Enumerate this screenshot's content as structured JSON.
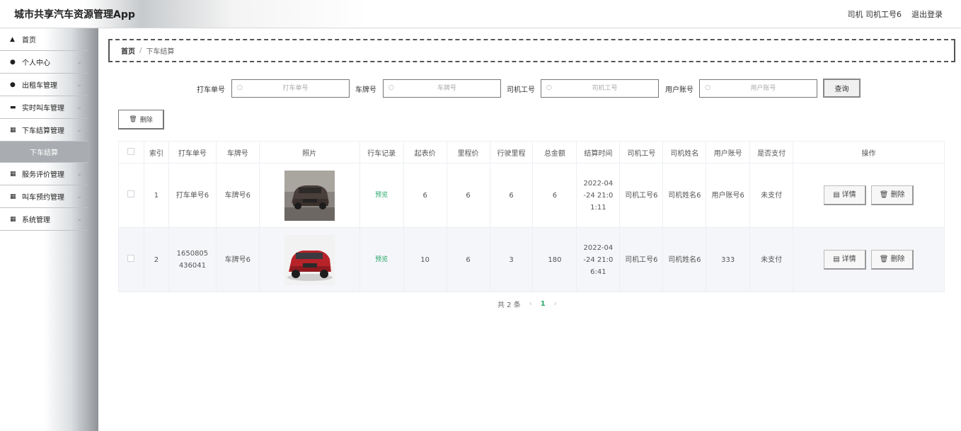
{
  "app": {
    "title": "城市共享汽车资源管理App"
  },
  "header": {
    "role_text": "司机 司机工号6",
    "logout_label": "退出登录"
  },
  "sidebar": {
    "items": [
      {
        "label": "首页",
        "icon": "home-icon",
        "has_chevron": false
      },
      {
        "label": "个人中心",
        "icon": "user-icon",
        "has_chevron": true
      },
      {
        "label": "出租车管理",
        "icon": "user-icon",
        "has_chevron": true
      },
      {
        "label": "实时叫车管理",
        "icon": "monitor-icon",
        "has_chevron": true
      },
      {
        "label": "下车结算管理",
        "icon": "grid-icon",
        "has_chevron": true
      },
      {
        "label": "下车结算",
        "icon": "",
        "has_chevron": false,
        "sub": true
      },
      {
        "label": "服务评价管理",
        "icon": "grid-icon",
        "has_chevron": true
      },
      {
        "label": "叫车预约管理",
        "icon": "grid-icon",
        "has_chevron": true
      },
      {
        "label": "系统管理",
        "icon": "grid-icon",
        "has_chevron": true
      }
    ]
  },
  "breadcrumb": {
    "home": "首页",
    "separator": "/",
    "current": "下车结算"
  },
  "search": {
    "fields": [
      {
        "label": "打车单号",
        "placeholder": "打车单号"
      },
      {
        "label": "车牌号",
        "placeholder": "车牌号"
      },
      {
        "label": "司机工号",
        "placeholder": "司机工号"
      },
      {
        "label": "用户账号",
        "placeholder": "用户账号"
      }
    ],
    "query_label": "查询"
  },
  "toolbar": {
    "delete_label": "删除"
  },
  "table": {
    "headers": [
      "",
      "索引",
      "打车单号",
      "车牌号",
      "照片",
      "行车记录",
      "起表价",
      "里程价",
      "行驶里程",
      "总金额",
      "结算时间",
      "司机工号",
      "司机姓名",
      "用户账号",
      "是否支付",
      "操作"
    ],
    "rows": [
      {
        "index": "1",
        "order_no": "打车单号6",
        "plate": "车牌号6",
        "photo": "dark-suv-photo",
        "record": "预览",
        "start_price": "6",
        "mileage_price": "6",
        "distance": "6",
        "total": "6",
        "time": "2022-04-24 21:01:11",
        "driver_id": "司机工号6",
        "driver_name": "司机姓名6",
        "user_account": "用户账号6",
        "paid": "未支付"
      },
      {
        "index": "2",
        "order_no": "1650805436041",
        "plate": "车牌号6",
        "photo": "red-suv-photo",
        "record": "预览",
        "start_price": "10",
        "mileage_price": "6",
        "distance": "3",
        "total": "180",
        "time": "2022-04-24 21:06:41",
        "driver_id": "司机工号6",
        "driver_name": "司机姓名6",
        "user_account": "333",
        "paid": "未支付"
      }
    ],
    "detail_label": "详情",
    "delete_label": "删除"
  },
  "pagination": {
    "total_text": "共 2 条",
    "current_page": "1"
  }
}
